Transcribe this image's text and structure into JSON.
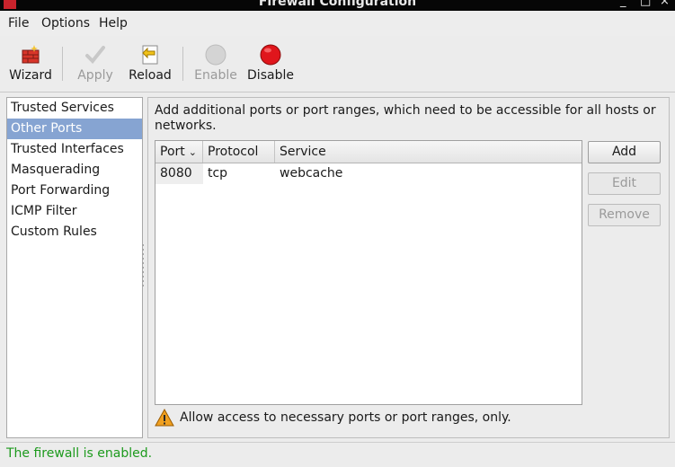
{
  "window": {
    "title": "Firewall Configuration",
    "controls": [
      "_",
      "□",
      "×"
    ]
  },
  "menu": [
    "File",
    "Options",
    "Help"
  ],
  "toolbar": {
    "wizard": "Wizard",
    "apply": "Apply",
    "reload": "Reload",
    "enable": "Enable",
    "disable": "Disable"
  },
  "sidebar": {
    "items": [
      {
        "label": "Trusted Services"
      },
      {
        "label": "Other Ports"
      },
      {
        "label": "Trusted Interfaces"
      },
      {
        "label": "Masquerading"
      },
      {
        "label": "Port Forwarding"
      },
      {
        "label": "ICMP Filter"
      },
      {
        "label": "Custom Rules"
      }
    ],
    "selected": "Other Ports"
  },
  "panel": {
    "description": "Add additional ports or port ranges, which need to be accessible for all hosts or networks.",
    "columns": [
      "Port",
      "Protocol",
      "Service"
    ],
    "rows": [
      {
        "port": "8080",
        "protocol": "tcp",
        "service": "webcache"
      }
    ],
    "buttons": {
      "add": "Add",
      "edit": "Edit",
      "remove": "Remove"
    },
    "hint": "Allow access to necessary ports or port ranges, only."
  },
  "status": {
    "text": "The firewall is enabled.",
    "color": "#1d9a1d"
  },
  "colors": {
    "selection": "#86a4d2",
    "disable_red": "#e0161c",
    "warning": "#f0a020"
  }
}
